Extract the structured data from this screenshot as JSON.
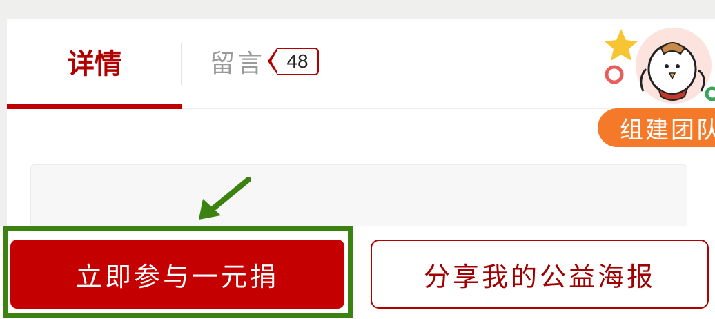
{
  "tabs": {
    "details_label": "详情",
    "comments_label": "留言",
    "comments_count": "48"
  },
  "team_widget": {
    "label": "组建团队",
    "icon": "cartoon-chicken-mascot"
  },
  "actions": {
    "donate_label": "立即参与一元捐",
    "share_label": "分享我的公益海报"
  },
  "colors": {
    "brand_red": "#c40000",
    "team_orange": "#f47a2a",
    "highlight_green": "#3c8210"
  }
}
